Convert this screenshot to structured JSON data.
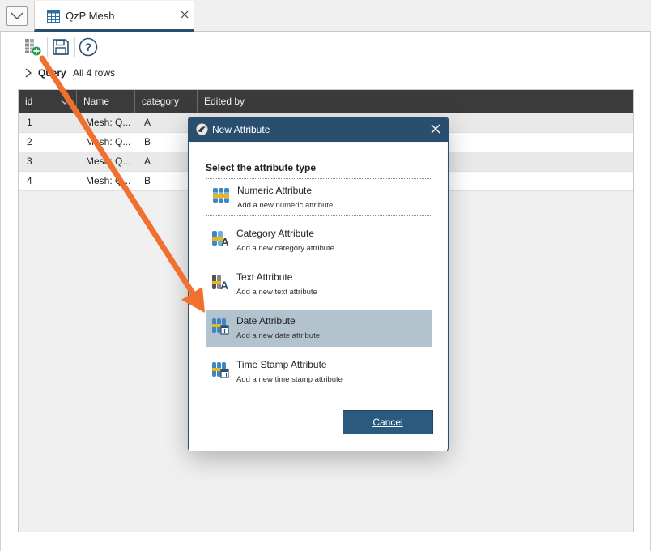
{
  "tab": {
    "label": "QzP Mesh"
  },
  "toolbar": {
    "add_table_icon": "table-add-icon",
    "save_icon": "save-icon",
    "help_icon": "help-icon"
  },
  "query": {
    "label": "Query",
    "rows_text": "All 4 rows"
  },
  "grid": {
    "columns": [
      "id",
      "Name",
      "category",
      "Edited by"
    ],
    "rows": [
      {
        "id": "1",
        "name": "Mesh: Q...",
        "category": "A"
      },
      {
        "id": "2",
        "name": "Mesh: Q...",
        "category": "B"
      },
      {
        "id": "3",
        "name": "Mesh: Q...",
        "category": "A"
      },
      {
        "id": "4",
        "name": "Mesh: Q...",
        "category": "B"
      }
    ]
  },
  "dialog": {
    "title": "New Attribute",
    "subtitle": "Select the attribute type",
    "options": [
      {
        "label": "Numeric Attribute",
        "desc": "Add a new numeric attribute",
        "icon": "numeric-attribute-icon"
      },
      {
        "label": "Category Attribute",
        "desc": "Add a new category attribute",
        "icon": "category-attribute-icon"
      },
      {
        "label": "Text Attribute",
        "desc": "Add a new text attribute",
        "icon": "text-attribute-icon"
      },
      {
        "label": "Date Attribute",
        "desc": "Add a new date attribute",
        "icon": "date-attribute-icon"
      },
      {
        "label": "Time Stamp Attribute",
        "desc": "Add a new time stamp attribute",
        "icon": "time-stamp-attribute-icon"
      }
    ],
    "selected_option": "Date Attribute",
    "cancel_label": "Cancel"
  },
  "colors": {
    "accent": "#2a4e6e",
    "selection": "#b2c3ce",
    "annotation_arrow": "#f07030",
    "header_bg": "#3b3b3b"
  }
}
